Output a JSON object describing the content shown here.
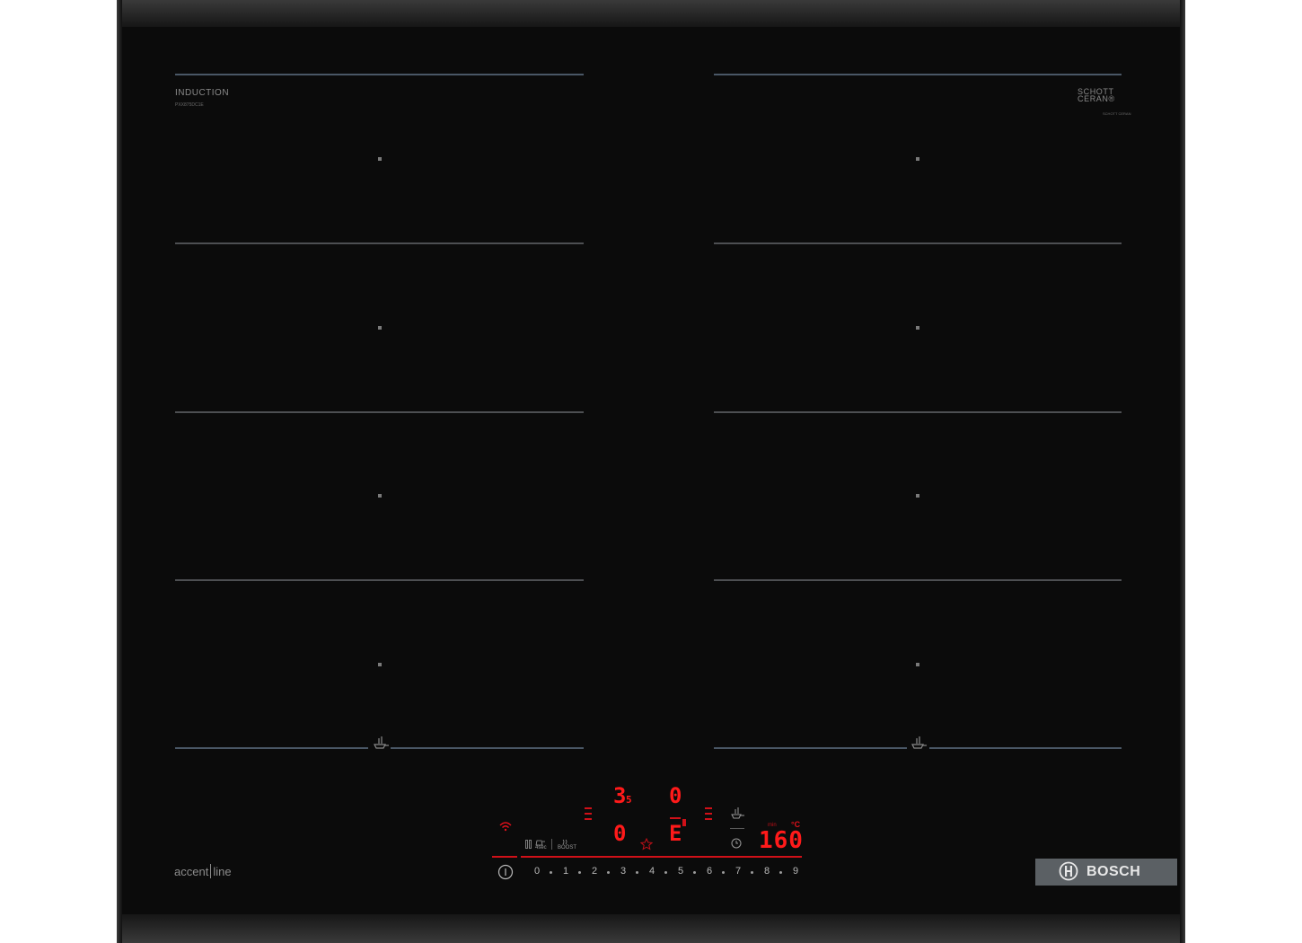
{
  "brand": {
    "induction_label": "INDUCTION",
    "model_small": "PXX875DC1E",
    "schott_line1": "SCHOTT",
    "schott_line2": "CERAN®",
    "schott_small": "SCHOTT CERAN",
    "accent_part1": "accent",
    "accent_part2": "line",
    "bosch": "BOSCH"
  },
  "display": {
    "zone_top_left_value": "3",
    "zone_top_left_sub": "5",
    "zone_top_right_value": "0",
    "zone_bottom_left_value": "0",
    "zone_bottom_right_value": "E",
    "timer_value": "160",
    "temp_unit": "°C",
    "min_label": "min"
  },
  "controls": {
    "boost_label": "BOOST",
    "sec_label": "4sec",
    "scale": [
      "0",
      "1",
      "2",
      "3",
      "4",
      "5",
      "6",
      "7",
      "8",
      "9"
    ]
  },
  "colors": {
    "glass": "#0b0b0b",
    "display_red": "#ff1a1a",
    "zone_line": "#4d4f52",
    "bosch_plate": "#5b6064"
  }
}
